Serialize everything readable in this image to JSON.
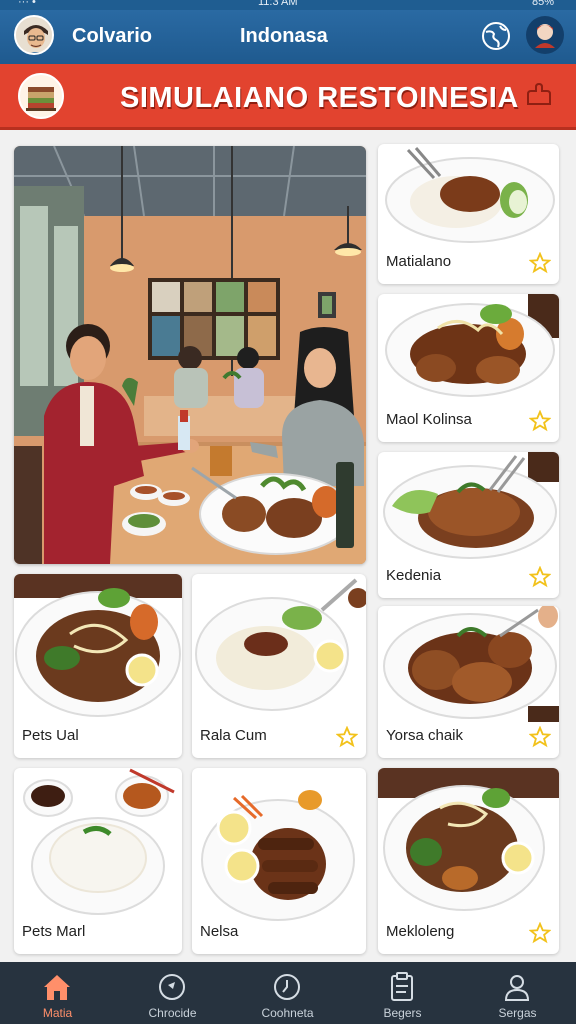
{
  "status_bar": {
    "left": "··· •",
    "time": "11:3 AM",
    "battery": "85%"
  },
  "header": {
    "user_name": "Colvario",
    "region": "Indonasa"
  },
  "banner": {
    "title": "SIMULAIANO RESTOINESIA"
  },
  "dishes": [
    {
      "name": "Matialano",
      "favorited": true
    },
    {
      "name": "Maol Kolinsa",
      "favorited": true
    },
    {
      "name": "Kedenia",
      "favorited": true
    },
    {
      "name": "Pets Ual",
      "favorited": false
    },
    {
      "name": "Rala Cum",
      "favorited": true
    },
    {
      "name": "Yorsa chaik",
      "favorited": true
    },
    {
      "name": "Pets Marl",
      "favorited": false
    },
    {
      "name": "Nelsa",
      "favorited": false
    },
    {
      "name": "Mekloleng",
      "favorited": true
    }
  ],
  "nav": [
    {
      "label": "Matia",
      "active": true
    },
    {
      "label": "Chrocide",
      "active": false
    },
    {
      "label": "Coohneta",
      "active": false
    },
    {
      "label": "Begers",
      "active": false
    },
    {
      "label": "Sergas",
      "active": false
    }
  ],
  "colors": {
    "header": "#2a6aa3",
    "banner": "#e2432f",
    "nav": "#27333f",
    "active": "#ff8f6a",
    "star": "#f2c21b"
  }
}
